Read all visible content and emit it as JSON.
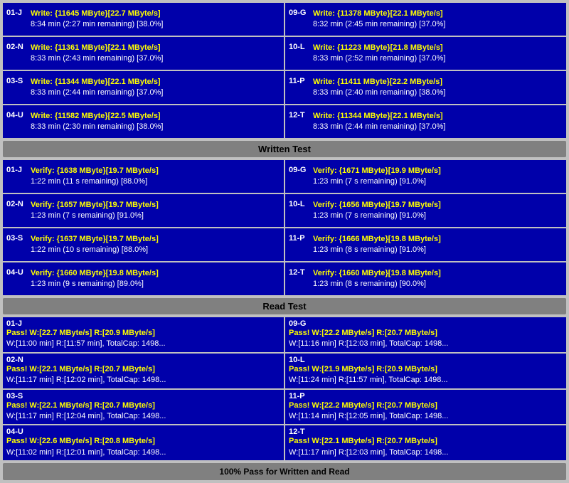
{
  "sections": {
    "write": {
      "label": "Written Test",
      "left": [
        {
          "id": "01-J",
          "line1": "Write: {11645 MByte}[22.7 MByte/s]",
          "line2": "8:34 min (2:27 min remaining)  [38.0%]"
        },
        {
          "id": "02-N",
          "line1": "Write: {11361 MByte}[22.1 MByte/s]",
          "line2": "8:33 min (2:43 min remaining)  [37.0%]"
        },
        {
          "id": "03-S",
          "line1": "Write: {11344 MByte}[22.1 MByte/s]",
          "line2": "8:33 min (2:44 min remaining)  [37.0%]"
        },
        {
          "id": "04-U",
          "line1": "Write: {11582 MByte}[22.5 MByte/s]",
          "line2": "8:33 min (2:30 min remaining)  [38.0%]"
        }
      ],
      "right": [
        {
          "id": "09-G",
          "line1": "Write: {11378 MByte}[22.1 MByte/s]",
          "line2": "8:32 min (2:45 min remaining)  [37.0%]"
        },
        {
          "id": "10-L",
          "line1": "Write: {11223 MByte}[21.8 MByte/s]",
          "line2": "8:33 min (2:52 min remaining)  [37.0%]"
        },
        {
          "id": "11-P",
          "line1": "Write: {11411 MByte}[22.2 MByte/s]",
          "line2": "8:33 min (2:40 min remaining)  [38.0%]"
        },
        {
          "id": "12-T",
          "line1": "Write: {11344 MByte}[22.1 MByte/s]",
          "line2": "8:33 min (2:44 min remaining)  [37.0%]"
        }
      ]
    },
    "verify": {
      "label": "Written Test",
      "left": [
        {
          "id": "01-J",
          "line1": "Verify: {1638 MByte}[19.7 MByte/s]",
          "line2": "1:22 min (11 s remaining)   [88.0%]"
        },
        {
          "id": "02-N",
          "line1": "Verify: {1657 MByte}[19.7 MByte/s]",
          "line2": "1:23 min (7 s remaining)   [91.0%]"
        },
        {
          "id": "03-S",
          "line1": "Verify: {1637 MByte}[19.7 MByte/s]",
          "line2": "1:22 min (10 s remaining)   [88.0%]"
        },
        {
          "id": "04-U",
          "line1": "Verify: {1660 MByte}[19.8 MByte/s]",
          "line2": "1:23 min (9 s remaining)   [89.0%]"
        }
      ],
      "right": [
        {
          "id": "09-G",
          "line1": "Verify: {1671 MByte}[19.9 MByte/s]",
          "line2": "1:23 min (7 s remaining)   [91.0%]"
        },
        {
          "id": "10-L",
          "line1": "Verify: {1656 MByte}[19.7 MByte/s]",
          "line2": "1:23 min (7 s remaining)   [91.0%]"
        },
        {
          "id": "11-P",
          "line1": "Verify: {1666 MByte}[19.8 MByte/s]",
          "line2": "1:23 min (8 s remaining)   [91.0%]"
        },
        {
          "id": "12-T",
          "line1": "Verify: {1660 MByte}[19.8 MByte/s]",
          "line2": "1:23 min (8 s remaining)   [90.0%]"
        }
      ]
    },
    "read": {
      "label": "Read Test",
      "left": [
        {
          "id": "01-J",
          "line1": "Pass! W:[22.7 MByte/s] R:[20.9 MByte/s]",
          "line2": "W:[11:00 min] R:[11:57 min], TotalCap: 1498..."
        },
        {
          "id": "02-N",
          "line1": "Pass! W:[22.1 MByte/s] R:[20.7 MByte/s]",
          "line2": "W:[11:17 min] R:[12:02 min], TotalCap: 1498..."
        },
        {
          "id": "03-S",
          "line1": "Pass! W:[22.1 MByte/s] R:[20.7 MByte/s]",
          "line2": "W:[11:17 min] R:[12:04 min], TotalCap: 1498..."
        },
        {
          "id": "04-U",
          "line1": "Pass! W:[22.6 MByte/s] R:[20.8 MByte/s]",
          "line2": "W:[11:02 min] R:[12:01 min], TotalCap: 1498..."
        }
      ],
      "right": [
        {
          "id": "09-G",
          "line1": "Pass! W:[22.2 MByte/s] R:[20.7 MByte/s]",
          "line2": "W:[11:16 min] R:[12:03 min], TotalCap: 1498..."
        },
        {
          "id": "10-L",
          "line1": "Pass! W:[21.9 MByte/s] R:[20.9 MByte/s]",
          "line2": "W:[11:24 min] R:[11:57 min], TotalCap: 1498..."
        },
        {
          "id": "11-P",
          "line1": "Pass! W:[22.2 MByte/s] R:[20.7 MByte/s]",
          "line2": "W:[11:14 min] R:[12:05 min], TotalCap: 1498..."
        },
        {
          "id": "12-T",
          "line1": "Pass! W:[22.1 MByte/s] R:[20.7 MByte/s]",
          "line2": "W:[11:17 min] R:[12:03 min], TotalCap: 1498..."
        }
      ]
    }
  },
  "footer": "100% Pass for Written and Read",
  "written_test_label": "Written Test",
  "read_test_label": "Read Test"
}
